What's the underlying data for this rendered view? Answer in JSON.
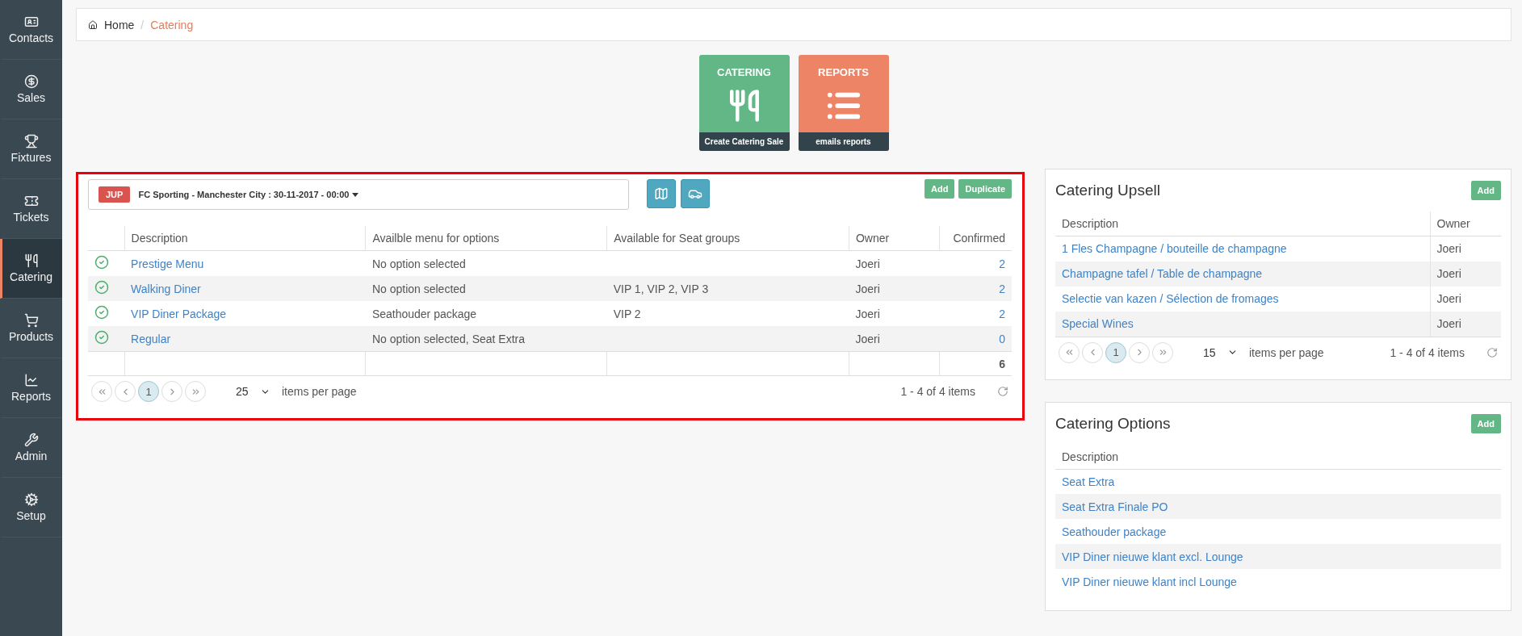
{
  "sidebar": {
    "items": [
      {
        "label": "Contacts",
        "selected": false
      },
      {
        "label": "Sales",
        "selected": false
      },
      {
        "label": "Fixtures",
        "selected": false
      },
      {
        "label": "Tickets",
        "selected": false
      },
      {
        "label": "Catering",
        "selected": true
      },
      {
        "label": "Products",
        "selected": false
      },
      {
        "label": "Reports",
        "selected": false
      },
      {
        "label": "Admin",
        "selected": false
      },
      {
        "label": "Setup",
        "selected": false
      }
    ]
  },
  "breadcrumb_separator": "/",
  "breadcrumb": [
    {
      "label": "Home",
      "current": false
    },
    {
      "label": "Catering",
      "current": true
    }
  ],
  "tiles": [
    {
      "kind": "catering",
      "title": "CATERING",
      "caption": "Create Catering Sale",
      "color": "#63b787"
    },
    {
      "kind": "reports",
      "title": "REPORTS",
      "caption": "emails reports",
      "color": "#ee8466"
    }
  ],
  "catering_panel": {
    "event": {
      "badge": "JUP",
      "label": "FC Sporting - Manchester City : 30-11-2017 - 00:00"
    },
    "buttons": [
      "Add",
      "Duplicate"
    ],
    "columns": [
      "Description",
      "Availble menu for options",
      "Available for Seat groups",
      "Owner",
      "Confirmed"
    ],
    "rows": [
      {
        "description": "Prestige Menu",
        "menu": "No option selected",
        "seat_groups": "",
        "owner": "Joeri",
        "confirmed": "2"
      },
      {
        "description": "Walking Diner",
        "menu": "No option selected",
        "seat_groups": "VIP 1, VIP 2, VIP 3",
        "owner": "Joeri",
        "confirmed": "2"
      },
      {
        "description": "VIP Diner Package",
        "menu": "Seathouder package",
        "seat_groups": "VIP 2",
        "owner": "Joeri",
        "confirmed": "2"
      },
      {
        "description": "Regular",
        "menu": "No option selected, Seat Extra",
        "seat_groups": "",
        "owner": "Joeri",
        "confirmed": "0"
      }
    ],
    "total": "6",
    "pager": {
      "pages": [
        {
          "label": "1",
          "selected": true
        }
      ],
      "page_size": "25",
      "per_page_label": "items per page",
      "summary": "1 - 4 of 4 items"
    }
  },
  "upsell_panel": {
    "title": "Catering Upsell",
    "button": "Add",
    "columns": [
      "Description",
      "Owner"
    ],
    "rows": [
      {
        "description": "1 Fles Champagne / bouteille de champagne",
        "owner": "Joeri"
      },
      {
        "description": "Champagne tafel / Table de champagne",
        "owner": "Joeri"
      },
      {
        "description": "Selectie van kazen / Sélection de fromages",
        "owner": "Joeri"
      },
      {
        "description": "Special Wines",
        "owner": "Joeri"
      }
    ],
    "pager": {
      "pages": [
        {
          "label": "1",
          "selected": true
        }
      ],
      "page_size": "15",
      "per_page_label": "items per page",
      "summary": "1 - 4 of 4 items"
    }
  },
  "options_panel": {
    "title": "Catering Options",
    "button": "Add",
    "columns": [
      "Description"
    ],
    "rows": [
      "Seat Extra",
      "Seat Extra Finale PO",
      "Seathouder package",
      "VIP Diner nieuwe klant excl. Lounge",
      "VIP Diner nieuwe klant incl Lounge"
    ]
  }
}
